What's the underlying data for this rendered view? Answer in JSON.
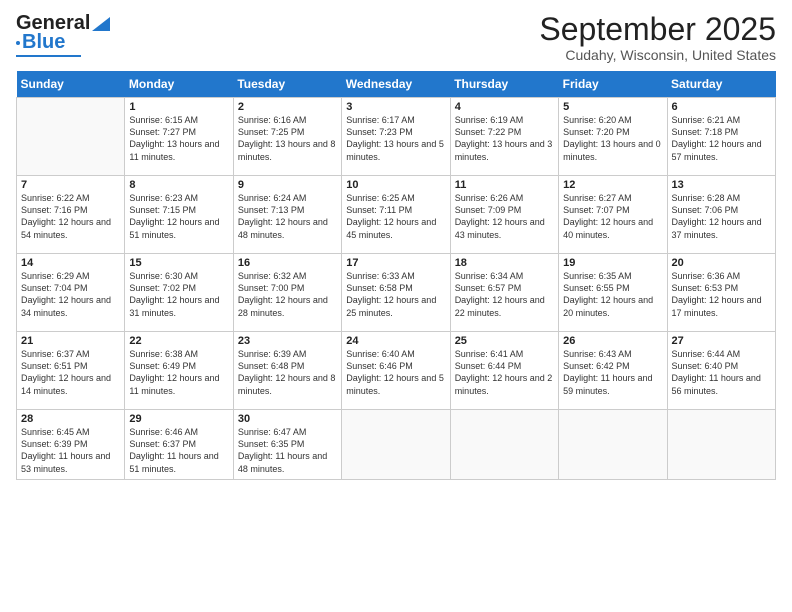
{
  "header": {
    "logo_line1": "General",
    "logo_line2": "Blue",
    "month": "September 2025",
    "location": "Cudahy, Wisconsin, United States"
  },
  "weekdays": [
    "Sunday",
    "Monday",
    "Tuesday",
    "Wednesday",
    "Thursday",
    "Friday",
    "Saturday"
  ],
  "weeks": [
    [
      {
        "day": "",
        "sunrise": "",
        "sunset": "",
        "daylight": ""
      },
      {
        "day": "1",
        "sunrise": "Sunrise: 6:15 AM",
        "sunset": "Sunset: 7:27 PM",
        "daylight": "Daylight: 13 hours and 11 minutes."
      },
      {
        "day": "2",
        "sunrise": "Sunrise: 6:16 AM",
        "sunset": "Sunset: 7:25 PM",
        "daylight": "Daylight: 13 hours and 8 minutes."
      },
      {
        "day": "3",
        "sunrise": "Sunrise: 6:17 AM",
        "sunset": "Sunset: 7:23 PM",
        "daylight": "Daylight: 13 hours and 5 minutes."
      },
      {
        "day": "4",
        "sunrise": "Sunrise: 6:19 AM",
        "sunset": "Sunset: 7:22 PM",
        "daylight": "Daylight: 13 hours and 3 minutes."
      },
      {
        "day": "5",
        "sunrise": "Sunrise: 6:20 AM",
        "sunset": "Sunset: 7:20 PM",
        "daylight": "Daylight: 13 hours and 0 minutes."
      },
      {
        "day": "6",
        "sunrise": "Sunrise: 6:21 AM",
        "sunset": "Sunset: 7:18 PM",
        "daylight": "Daylight: 12 hours and 57 minutes."
      }
    ],
    [
      {
        "day": "7",
        "sunrise": "Sunrise: 6:22 AM",
        "sunset": "Sunset: 7:16 PM",
        "daylight": "Daylight: 12 hours and 54 minutes."
      },
      {
        "day": "8",
        "sunrise": "Sunrise: 6:23 AM",
        "sunset": "Sunset: 7:15 PM",
        "daylight": "Daylight: 12 hours and 51 minutes."
      },
      {
        "day": "9",
        "sunrise": "Sunrise: 6:24 AM",
        "sunset": "Sunset: 7:13 PM",
        "daylight": "Daylight: 12 hours and 48 minutes."
      },
      {
        "day": "10",
        "sunrise": "Sunrise: 6:25 AM",
        "sunset": "Sunset: 7:11 PM",
        "daylight": "Daylight: 12 hours and 45 minutes."
      },
      {
        "day": "11",
        "sunrise": "Sunrise: 6:26 AM",
        "sunset": "Sunset: 7:09 PM",
        "daylight": "Daylight: 12 hours and 43 minutes."
      },
      {
        "day": "12",
        "sunrise": "Sunrise: 6:27 AM",
        "sunset": "Sunset: 7:07 PM",
        "daylight": "Daylight: 12 hours and 40 minutes."
      },
      {
        "day": "13",
        "sunrise": "Sunrise: 6:28 AM",
        "sunset": "Sunset: 7:06 PM",
        "daylight": "Daylight: 12 hours and 37 minutes."
      }
    ],
    [
      {
        "day": "14",
        "sunrise": "Sunrise: 6:29 AM",
        "sunset": "Sunset: 7:04 PM",
        "daylight": "Daylight: 12 hours and 34 minutes."
      },
      {
        "day": "15",
        "sunrise": "Sunrise: 6:30 AM",
        "sunset": "Sunset: 7:02 PM",
        "daylight": "Daylight: 12 hours and 31 minutes."
      },
      {
        "day": "16",
        "sunrise": "Sunrise: 6:32 AM",
        "sunset": "Sunset: 7:00 PM",
        "daylight": "Daylight: 12 hours and 28 minutes."
      },
      {
        "day": "17",
        "sunrise": "Sunrise: 6:33 AM",
        "sunset": "Sunset: 6:58 PM",
        "daylight": "Daylight: 12 hours and 25 minutes."
      },
      {
        "day": "18",
        "sunrise": "Sunrise: 6:34 AM",
        "sunset": "Sunset: 6:57 PM",
        "daylight": "Daylight: 12 hours and 22 minutes."
      },
      {
        "day": "19",
        "sunrise": "Sunrise: 6:35 AM",
        "sunset": "Sunset: 6:55 PM",
        "daylight": "Daylight: 12 hours and 20 minutes."
      },
      {
        "day": "20",
        "sunrise": "Sunrise: 6:36 AM",
        "sunset": "Sunset: 6:53 PM",
        "daylight": "Daylight: 12 hours and 17 minutes."
      }
    ],
    [
      {
        "day": "21",
        "sunrise": "Sunrise: 6:37 AM",
        "sunset": "Sunset: 6:51 PM",
        "daylight": "Daylight: 12 hours and 14 minutes."
      },
      {
        "day": "22",
        "sunrise": "Sunrise: 6:38 AM",
        "sunset": "Sunset: 6:49 PM",
        "daylight": "Daylight: 12 hours and 11 minutes."
      },
      {
        "day": "23",
        "sunrise": "Sunrise: 6:39 AM",
        "sunset": "Sunset: 6:48 PM",
        "daylight": "Daylight: 12 hours and 8 minutes."
      },
      {
        "day": "24",
        "sunrise": "Sunrise: 6:40 AM",
        "sunset": "Sunset: 6:46 PM",
        "daylight": "Daylight: 12 hours and 5 minutes."
      },
      {
        "day": "25",
        "sunrise": "Sunrise: 6:41 AM",
        "sunset": "Sunset: 6:44 PM",
        "daylight": "Daylight: 12 hours and 2 minutes."
      },
      {
        "day": "26",
        "sunrise": "Sunrise: 6:43 AM",
        "sunset": "Sunset: 6:42 PM",
        "daylight": "Daylight: 11 hours and 59 minutes."
      },
      {
        "day": "27",
        "sunrise": "Sunrise: 6:44 AM",
        "sunset": "Sunset: 6:40 PM",
        "daylight": "Daylight: 11 hours and 56 minutes."
      }
    ],
    [
      {
        "day": "28",
        "sunrise": "Sunrise: 6:45 AM",
        "sunset": "Sunset: 6:39 PM",
        "daylight": "Daylight: 11 hours and 53 minutes."
      },
      {
        "day": "29",
        "sunrise": "Sunrise: 6:46 AM",
        "sunset": "Sunset: 6:37 PM",
        "daylight": "Daylight: 11 hours and 51 minutes."
      },
      {
        "day": "30",
        "sunrise": "Sunrise: 6:47 AM",
        "sunset": "Sunset: 6:35 PM",
        "daylight": "Daylight: 11 hours and 48 minutes."
      },
      {
        "day": "",
        "sunrise": "",
        "sunset": "",
        "daylight": ""
      },
      {
        "day": "",
        "sunrise": "",
        "sunset": "",
        "daylight": ""
      },
      {
        "day": "",
        "sunrise": "",
        "sunset": "",
        "daylight": ""
      },
      {
        "day": "",
        "sunrise": "",
        "sunset": "",
        "daylight": ""
      }
    ]
  ]
}
